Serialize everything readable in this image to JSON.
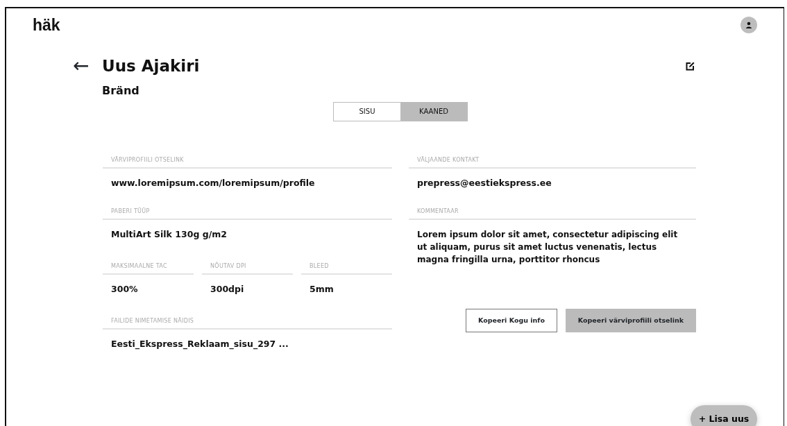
{
  "logo": "häk",
  "header": {
    "back": "←",
    "title": "Uus Ajakiri",
    "subtitle": "Bränd"
  },
  "tabs": [
    {
      "label": "SISU",
      "selected": false
    },
    {
      "label": "KAANED",
      "selected": true
    }
  ],
  "left_fields": [
    {
      "label": "VÄRVIPROFIILI OTSELINK",
      "value": "www.loremipsum.com/loremipsum/profile"
    },
    {
      "label": "PABERI TÜÜP",
      "value": "MultiArt Silk 130g g/m2"
    }
  ],
  "spec_fields": [
    {
      "label": "MAKSIMAALNE TAC",
      "value": "300%"
    },
    {
      "label": "NÕUTAV DPI",
      "value": "300dpi"
    },
    {
      "label": "BLEED",
      "value": "5mm"
    }
  ],
  "naming_field": {
    "label": "FAILIDE NIMETAMISE NÄIDIS",
    "value": "Eesti_Ekspress_Reklaam_sisu_297 ..."
  },
  "right_fields": [
    {
      "label": "VÄLJAANDE KONTAKT",
      "value": "prepress@eestiekspress.ee"
    },
    {
      "label": "KOMMENTAAR",
      "value": "Lorem ipsum dolor sit amet, consectetur adipiscing elit ut aliquam, purus sit amet luctus venenatis, lectus magna fringilla urna, porttitor rhoncus"
    }
  ],
  "buttons": [
    {
      "label": "Kopeeri Kogu info",
      "kind": "outline"
    },
    {
      "label": "Kopeeri värviprofiili otselink",
      "kind": "filled"
    }
  ],
  "fab": "+ Lisa uus"
}
